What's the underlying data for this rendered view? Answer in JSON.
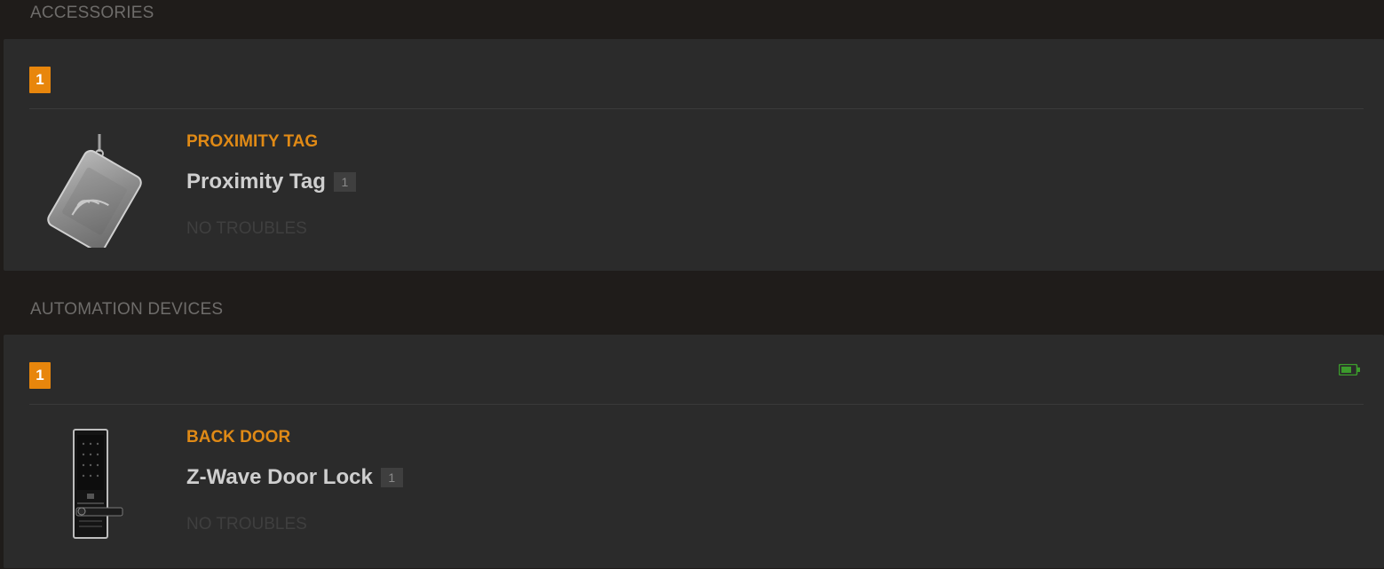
{
  "sections": [
    {
      "title": "ACCESSORIES",
      "group_count": "1",
      "device": {
        "location": "PROXIMITY TAG",
        "name": "Proximity Tag",
        "number": "1",
        "status": "NO TROUBLES",
        "image_icon": "proximity-tag-icon"
      }
    },
    {
      "title": "AUTOMATION DEVICES",
      "group_count": "1",
      "battery_icon": "battery-ok-icon",
      "device": {
        "location": "BACK DOOR",
        "name": "Z-Wave Door Lock",
        "number": "1",
        "status": "NO TROUBLES",
        "image_icon": "door-lock-icon"
      }
    }
  ],
  "colors": {
    "background": "#1f1c1a",
    "card": "#2b2b2b",
    "accent": "#e8860c",
    "battery_ok": "#3c9b2c"
  }
}
